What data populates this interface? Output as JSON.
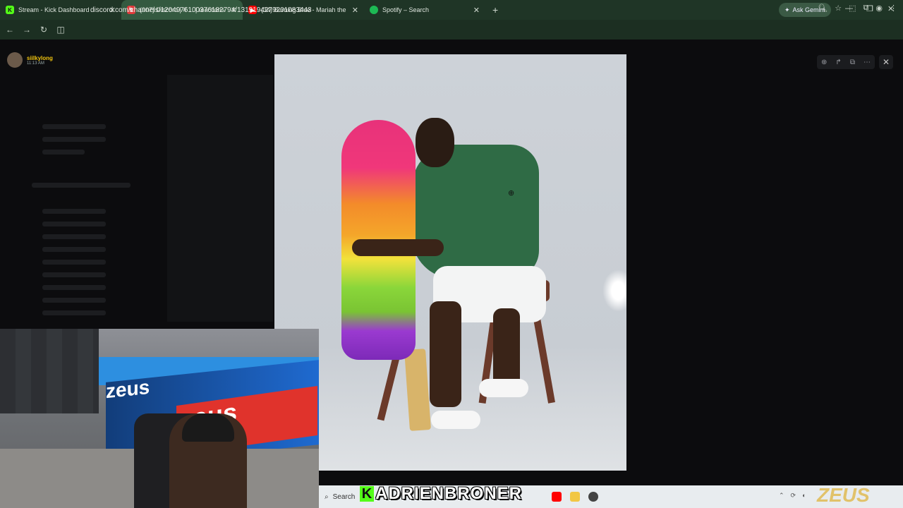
{
  "browser": {
    "tabs": [
      {
        "title": "Stream - Kick Dashboard",
        "favicon": "kick-icon",
        "color": "#53fc18",
        "active": false
      },
      {
        "title": "(907) Discord | # ... | reactions",
        "favicon": "discord-icon",
        "color": "#e03a3a",
        "active": true
      },
      {
        "title": "(34) Burning Blue - Mariah the",
        "favicon": "youtube-icon",
        "color": "#ff0000",
        "active": false
      },
      {
        "title": "Spotify – Search",
        "favicon": "spotify-icon",
        "color": "#1db954",
        "active": false
      }
    ],
    "new_tab": "+",
    "ask_gemini": "Ask Gemini",
    "url": "discord.com/channels/1204976100376182794/1319194279201083443"
  },
  "discord": {
    "user_name": "siilkylong",
    "user_time": "11:13 AM"
  },
  "viewer": {
    "controls": [
      "zoom-in-icon",
      "forward-icon",
      "open-external-icon",
      "more-icon"
    ],
    "close": "✕"
  },
  "overlay": {
    "kick_letter": "K",
    "streamer_name": "ADRIENBRONER",
    "watermark": "ZEUS",
    "webcam_brand": "zeus"
  },
  "taskbar": {
    "search_label": "Search"
  }
}
